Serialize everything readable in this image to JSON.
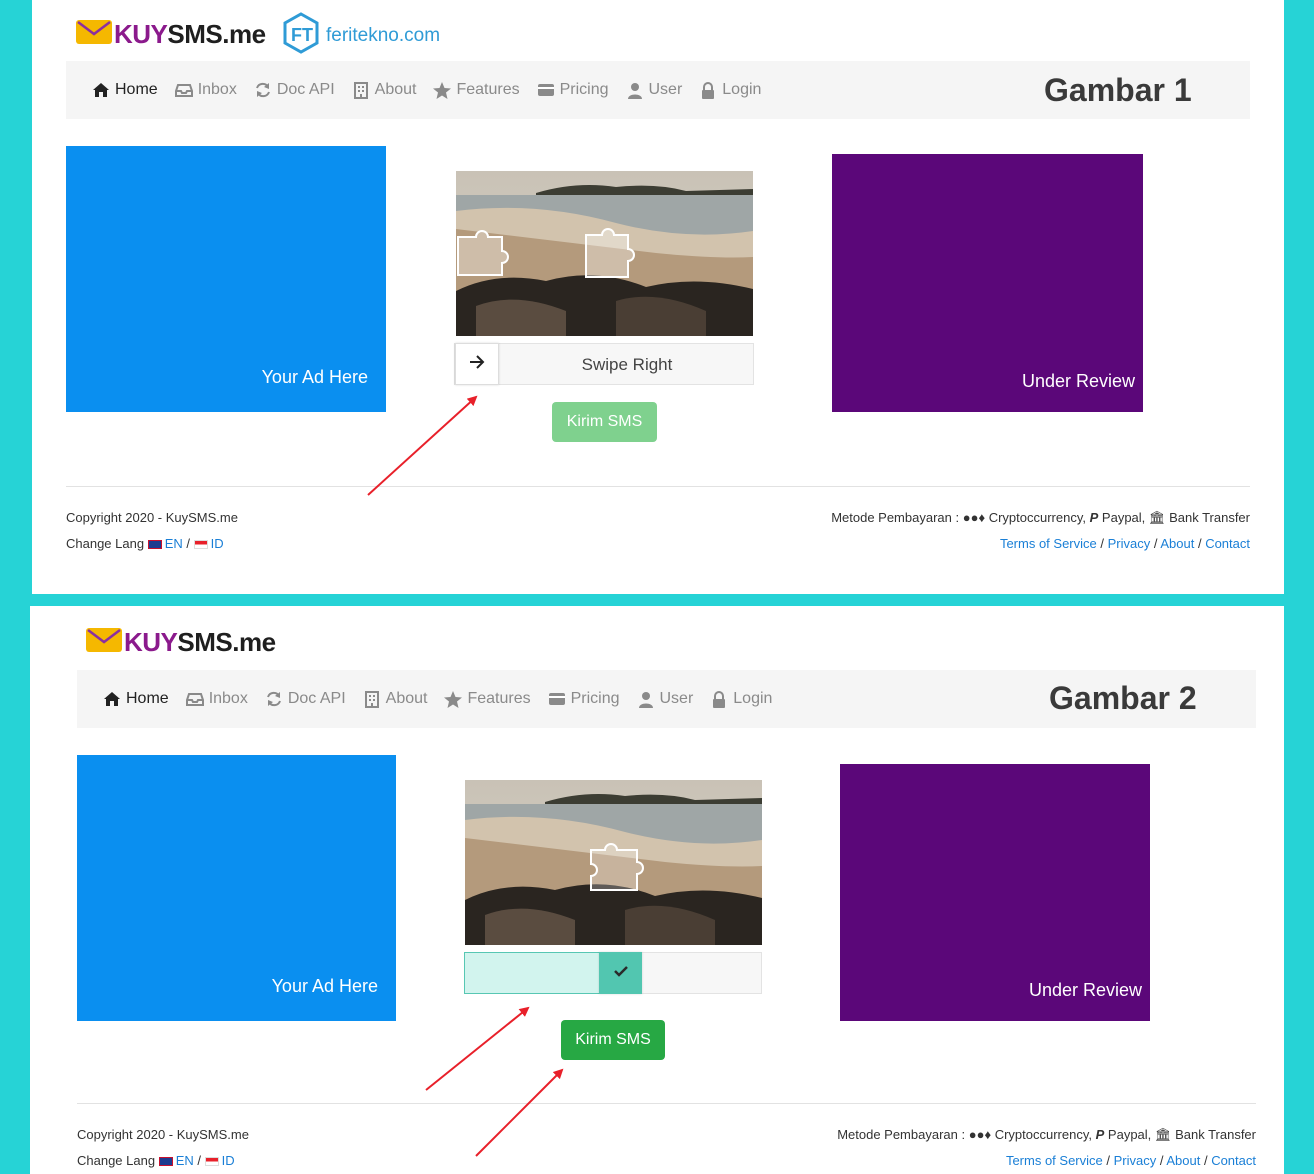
{
  "brand": {
    "name_prefix": "KUY",
    "name_suffix": "SMS.me"
  },
  "watermark": {
    "site": "feritekno.com"
  },
  "nav": {
    "items": [
      "Home",
      "Inbox",
      "Doc API",
      "About",
      "Features",
      "Pricing",
      "User",
      "Login"
    ]
  },
  "panel1": {
    "label": "Gambar 1",
    "slider_text": "Swipe Right",
    "send_label": "Kirim SMS"
  },
  "panel2": {
    "label": "Gambar 2",
    "send_label": "Kirim SMS"
  },
  "ads": {
    "left": "Your Ad Here",
    "right": "Under Review"
  },
  "footer": {
    "copyright": "Copyright 2020 - KuySMS.me",
    "change_lang": "Change Lang",
    "lang_en": "EN",
    "lang_sep": "/",
    "lang_id": "ID",
    "payment_label": "Metode Pembayaran :",
    "crypto": "Cryptoccurrency,",
    "paypal": "Paypal,",
    "bank": "Bank Transfer",
    "links": [
      "Terms of Service",
      "Privacy",
      "About",
      "Contact"
    ]
  },
  "colors": {
    "background": "#26d3d6",
    "ad_blue": "#0a8ff0",
    "ad_purple": "#5b0779",
    "button_green_faded": "#7fd18e",
    "button_green": "#27a844",
    "annotation_arrow": "#e8202a"
  }
}
